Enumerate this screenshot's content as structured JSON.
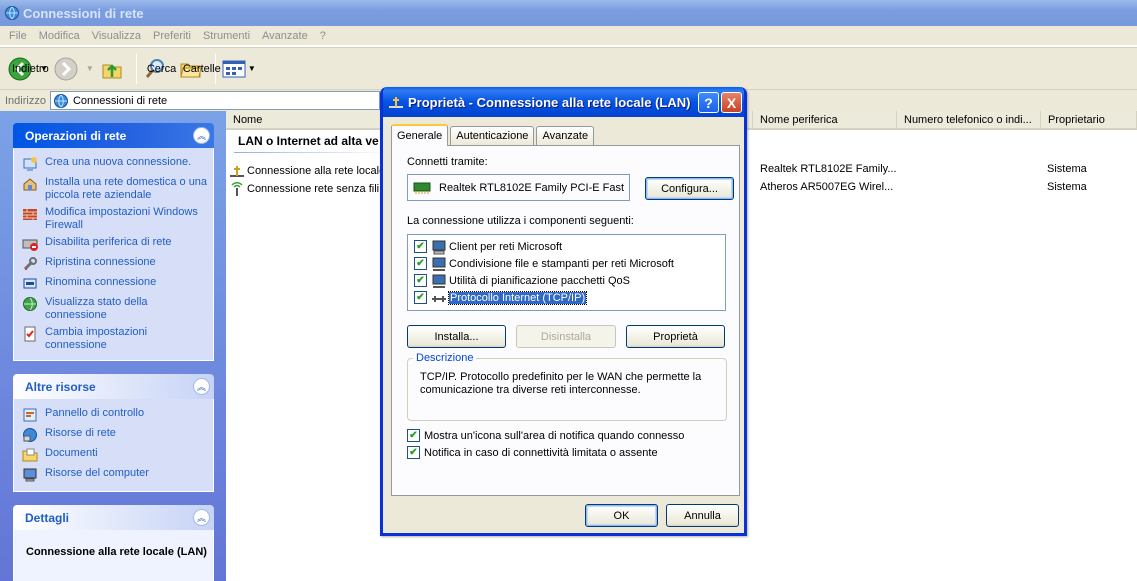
{
  "window": {
    "title": "Connessioni di rete"
  },
  "menu": [
    "File",
    "Modifica",
    "Visualizza",
    "Preferiti",
    "Strumenti",
    "Avanzate",
    "?"
  ],
  "toolbar": {
    "back": "Indietro",
    "search": "Cerca",
    "folders": "Cartelle"
  },
  "address": {
    "label": "Indirizzo",
    "value": "Connessioni di rete"
  },
  "taskpane": {
    "network_tasks": {
      "title": "Operazioni di rete",
      "items": [
        "Crea una nuova connessione.",
        "Installa una rete domestica o una piccola rete aziendale",
        "Modifica impostazioni Windows Firewall",
        "Disabilita periferica di rete",
        "Ripristina connessione",
        "Rinomina connessione",
        "Visualizza stato della connessione",
        "Cambia impostazioni connessione"
      ]
    },
    "other_places": {
      "title": "Altre risorse",
      "items": [
        "Pannello di controllo",
        "Risorse di rete",
        "Documenti",
        "Risorse del computer"
      ]
    },
    "details": {
      "title": "Dettagli",
      "name": "Connessione alla rete locale (LAN)"
    }
  },
  "list": {
    "columns": [
      "Nome",
      "Nome periferica",
      "Numero telefonico o indi...",
      "Proprietario"
    ],
    "group": "LAN o Internet ad alta ve",
    "rows": [
      {
        "name": "Connessione alla rete locale",
        "device": "Realtek RTL8102E Family...",
        "owner": "Sistema"
      },
      {
        "name": "Connessione rete senza fili 2",
        "device": "Atheros AR5007EG Wirel...",
        "owner": "Sistema"
      }
    ]
  },
  "dialog": {
    "title": "Proprietà - Connessione alla rete locale (LAN)",
    "help": "?",
    "close": "X",
    "tabs": [
      "Generale",
      "Autenticazione",
      "Avanzate"
    ],
    "connect_using_label": "Connetti tramite:",
    "adapter": "Realtek RTL8102E Family PCI-E Fast",
    "configure_button": "Configura...",
    "components_label": "La connessione utilizza i componenti seguenti:",
    "components": [
      {
        "label": "Client per reti Microsoft",
        "checked": "✔"
      },
      {
        "label": "Condivisione file e stampanti per reti Microsoft",
        "checked": "✔"
      },
      {
        "label": "Utilità di pianificazione pacchetti QoS",
        "checked": "✔"
      },
      {
        "label": "Protocollo Internet (TCP/IP)",
        "checked": "✔"
      }
    ],
    "install_button": "Installa...",
    "uninstall_button": "Disinstalla",
    "properties_button": "Proprietà",
    "description_legend": "Descrizione",
    "description_text": "TCP/IP. Protocollo predefinito per le WAN che permette la comunicazione tra diverse reti interconnesse.",
    "option_show_icon": "Mostra un'icona sull'area di notifica quando connesso",
    "option_notify": "Notifica in caso di connettività limitata o assente",
    "check_mark": "✔",
    "ok_button": "OK",
    "cancel_button": "Annulla"
  },
  "colors": {
    "dialog_title": "#0553e2",
    "link": "#215dc6",
    "selection": "#316ac5"
  }
}
